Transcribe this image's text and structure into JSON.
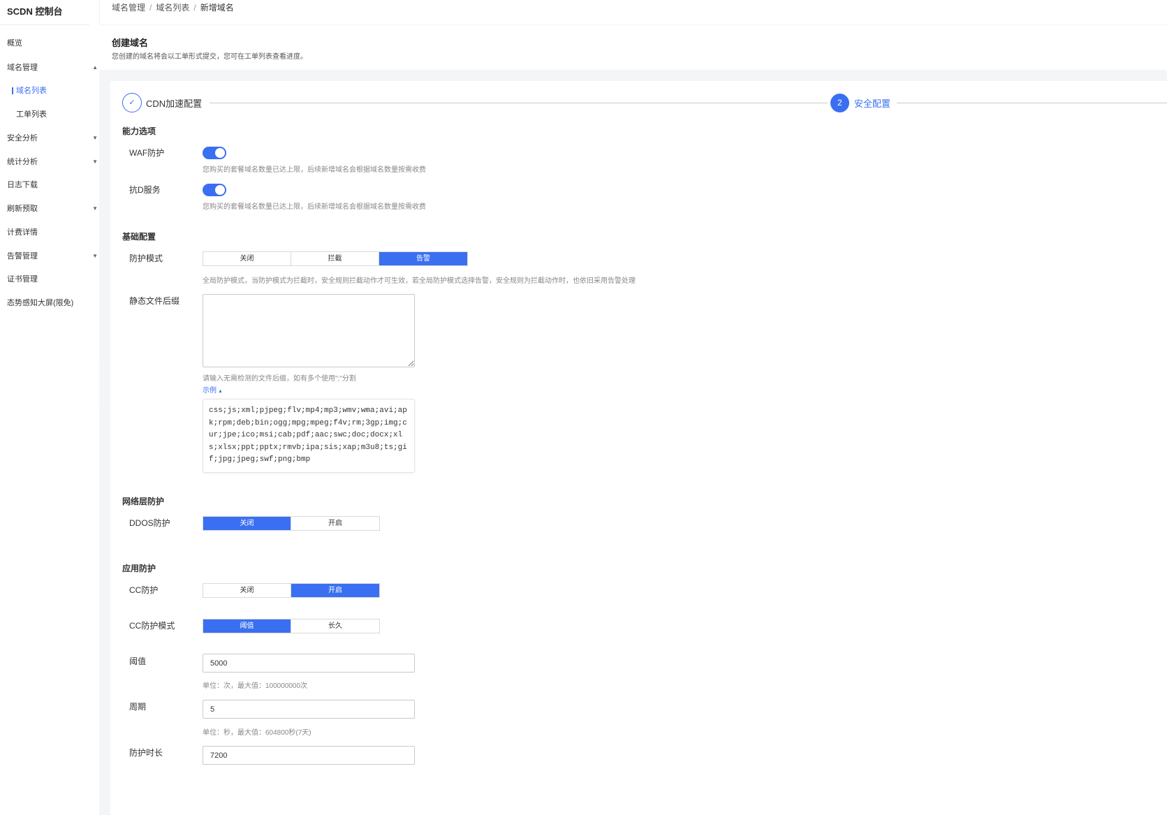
{
  "sidebar": {
    "brand": "SCDN 控制台",
    "items": [
      {
        "label": "概览"
      },
      {
        "label": "域名管理"
      },
      {
        "label": "域名列表"
      },
      {
        "label": "工单列表"
      },
      {
        "label": "安全分析"
      },
      {
        "label": "统计分析"
      },
      {
        "label": "日志下载"
      },
      {
        "label": "刷新预取"
      },
      {
        "label": "计费详情"
      },
      {
        "label": "告警管理"
      },
      {
        "label": "证书管理"
      },
      {
        "label": "态势感知大屏(限免)"
      }
    ]
  },
  "breadcrumb": [
    "域名管理",
    "域名列表",
    "新增域名"
  ],
  "header": {
    "title": "创建域名",
    "subtitle": "您创建的域名将会以工单形式提交，您可在工单列表查看进度。"
  },
  "steps": [
    {
      "label": "CDN加速配置",
      "marker": "✓"
    },
    {
      "label": "安全配置",
      "marker": "2"
    }
  ],
  "ability": {
    "title": "能力选项",
    "waf": {
      "label": "WAF防护",
      "enabled": true,
      "hint": "您购买的套餐域名数量已达上限，后续新增域名会根据域名数量按需收费"
    },
    "antid": {
      "label": "抗D服务",
      "enabled": true,
      "hint": "您购买的套餐域名数量已达上限，后续新增域名会根据域名数量按需收费"
    }
  },
  "basic": {
    "title": "基础配置",
    "mode": {
      "label": "防护模式",
      "options": [
        "关闭",
        "拦截",
        "告警"
      ],
      "selected": "告警",
      "hint": "全局防护模式，当防护模式为拦截时，安全规则拦截动作才可生效，若全局防护模式选择告警，安全规则为拦截动作时，也依旧采用告警处理"
    },
    "static": {
      "label": "静态文件后缀",
      "value": "",
      "hint": "请输入无需检测的文件后缀，如有多个使用\";\"分割",
      "example_link": "示例",
      "example": "css;js;xml;pjpeg;flv;mp4;mp3;wmv;wma;avi;apk;rpm;deb;bin;ogg;mpg;mpeg;f4v;rm;3gp;img;cur;jpe;ico;msi;cab;pdf;aac;swc;doc;docx;xls;xlsx;ppt;pptx;rmvb;ipa;sis;xap;m3u8;ts;gif;jpg;jpeg;swf;png;bmp"
    }
  },
  "network": {
    "title": "网络层防护",
    "ddos": {
      "label": "DDOS防护",
      "options": [
        "关闭",
        "开启"
      ],
      "selected": "关闭"
    }
  },
  "app": {
    "title": "应用防护",
    "cc": {
      "label": "CC防护",
      "options": [
        "关闭",
        "开启"
      ],
      "selected": "开启"
    },
    "cc_mode": {
      "label": "CC防护模式",
      "options": [
        "阈值",
        "长久"
      ],
      "selected": "阈值"
    },
    "threshold": {
      "label": "阈值",
      "value": "5000",
      "hint": "单位：次，最大值：100000000次"
    },
    "period": {
      "label": "周期",
      "value": "5",
      "hint": "单位：秒，最大值：604800秒(7天)"
    },
    "duration": {
      "label": "防护时长",
      "value": "7200"
    }
  },
  "colors": {
    "accent": "#3a6ff2"
  }
}
